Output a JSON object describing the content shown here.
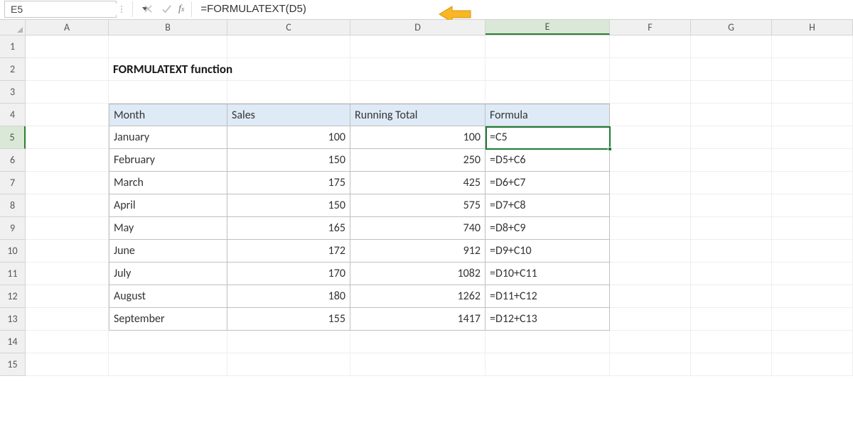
{
  "formula_bar": {
    "name_box": "E5",
    "formula": "=FORMULATEXT(D5)"
  },
  "columns": [
    "A",
    "B",
    "C",
    "D",
    "E",
    "F",
    "G",
    "H"
  ],
  "selected_column": "E",
  "row_count": 15,
  "selected_row": 5,
  "title_cell": "FORMULATEXT function",
  "headers": {
    "month": "Month",
    "sales": "Sales",
    "running_total": "Running Total",
    "formula": "Formula"
  },
  "chart_data": {
    "type": "table",
    "title": "FORMULATEXT function",
    "columns": [
      "Month",
      "Sales",
      "Running Total",
      "Formula"
    ],
    "rows": [
      {
        "month": "January",
        "sales": 100,
        "running_total": 100,
        "formula": "=C5"
      },
      {
        "month": "February",
        "sales": 150,
        "running_total": 250,
        "formula": "=D5+C6"
      },
      {
        "month": "March",
        "sales": 175,
        "running_total": 425,
        "formula": "=D6+C7"
      },
      {
        "month": "April",
        "sales": 150,
        "running_total": 575,
        "formula": "=D7+C8"
      },
      {
        "month": "May",
        "sales": 165,
        "running_total": 740,
        "formula": "=D8+C9"
      },
      {
        "month": "June",
        "sales": 172,
        "running_total": 912,
        "formula": "=D9+C10"
      },
      {
        "month": "July",
        "sales": 170,
        "running_total": 1082,
        "formula": "=D10+C11"
      },
      {
        "month": "August",
        "sales": 180,
        "running_total": 1262,
        "formula": "=D11+C12"
      },
      {
        "month": "September",
        "sales": 155,
        "running_total": 1417,
        "formula": "=D12+C13"
      }
    ]
  },
  "colors": {
    "header_fill": "#deebf6",
    "selection_border": "#1e7a36",
    "arrow": "#f8b723"
  }
}
